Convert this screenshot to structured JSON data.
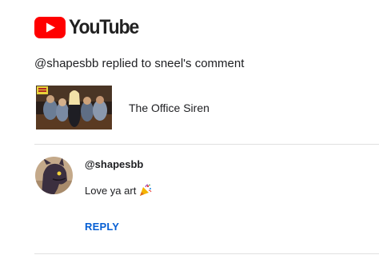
{
  "brand": {
    "name": "YouTube",
    "logo_icon": "youtube-play-icon",
    "accent_color": "#ff0000"
  },
  "notification": {
    "headline": "@shapesbb replied to sneel's comment"
  },
  "video": {
    "title": "The Office Siren",
    "thumbnail_icon": "video-thumbnail"
  },
  "reply_comment": {
    "author": "@shapesbb",
    "text": "Love ya art",
    "emoji_icon": "party-popper-icon",
    "reply_label": "REPLY",
    "link_color": "#065fd4"
  }
}
